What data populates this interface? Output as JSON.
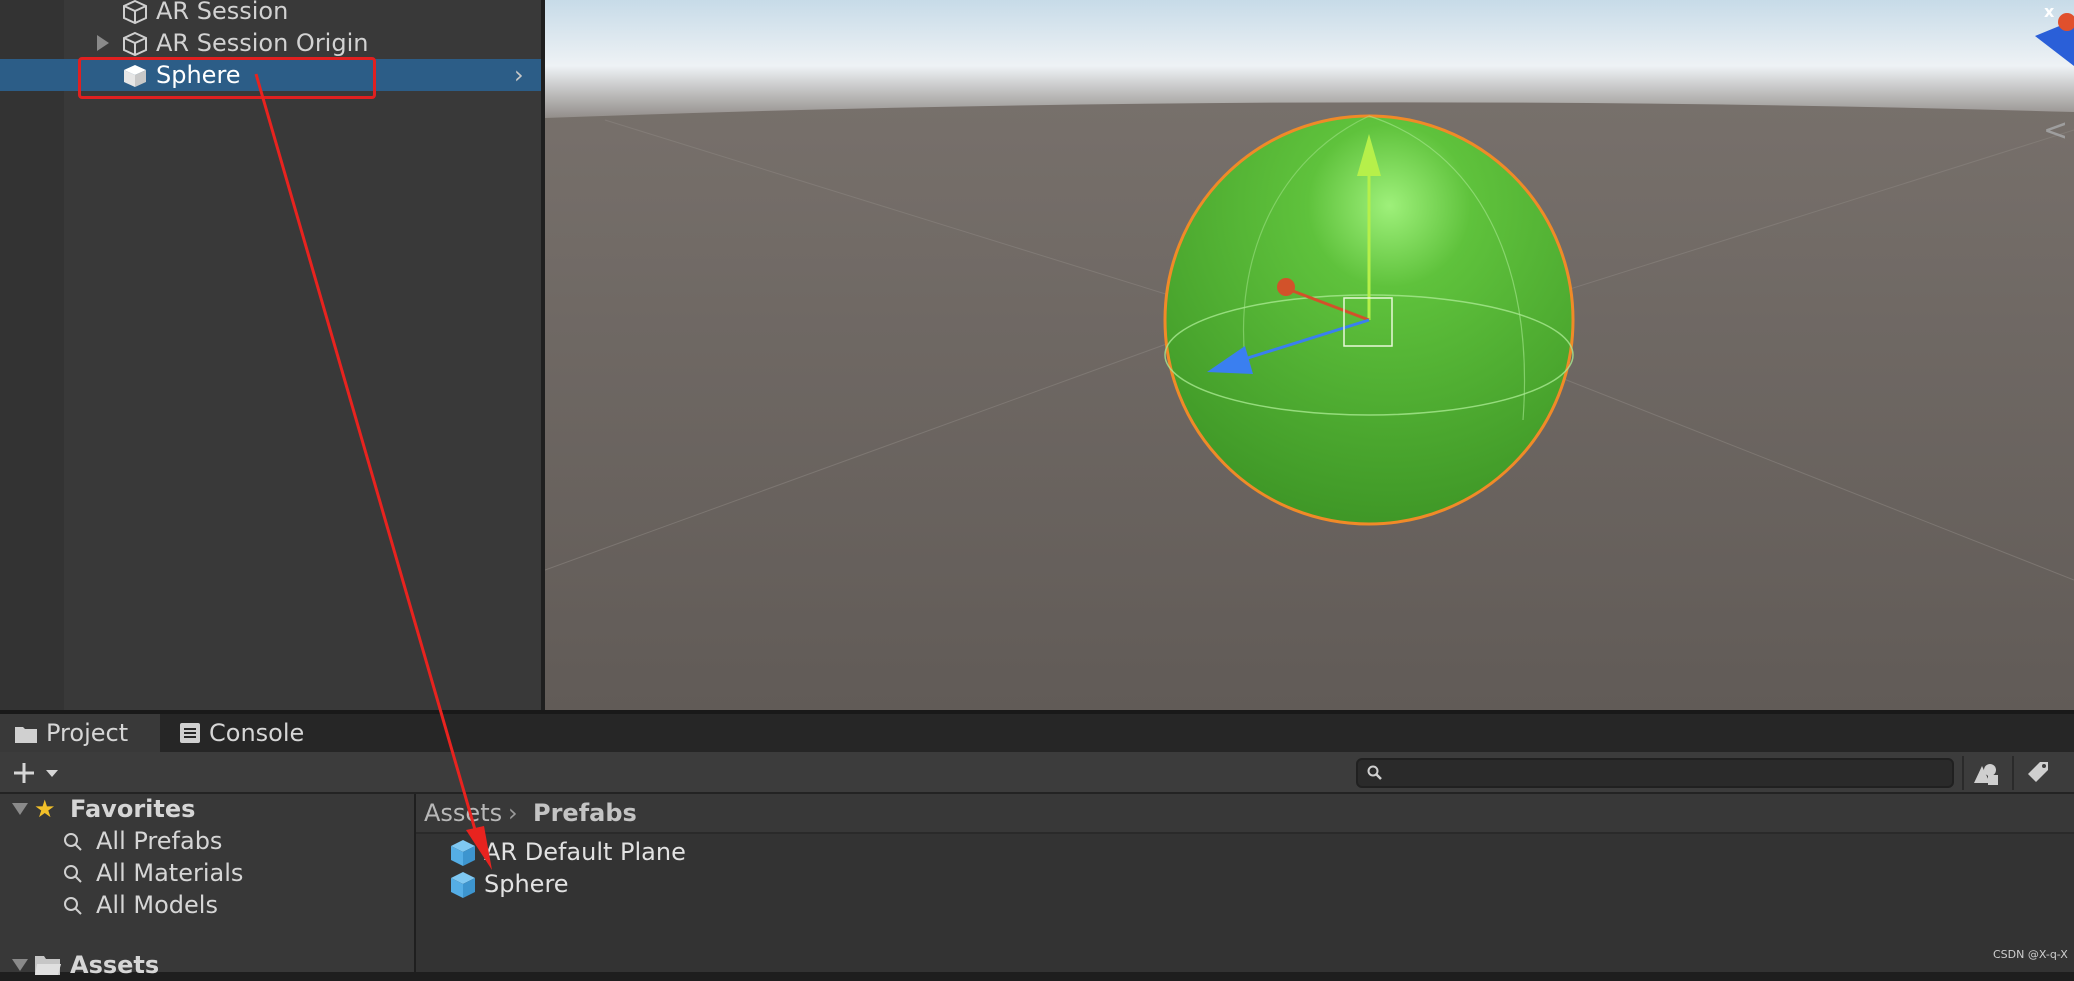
{
  "hierarchy": {
    "items": [
      {
        "label": "AR Session",
        "has_children": false,
        "selected": false
      },
      {
        "label": "AR Session Origin",
        "has_children": true,
        "selected": false
      },
      {
        "label": "Sphere",
        "has_children": false,
        "selected": true
      }
    ]
  },
  "scene_view": {
    "axis_label": "x",
    "selected_object": "Sphere",
    "object_color": "#4ea32e",
    "outline_color": "#f08a28",
    "gizmo_colors": {
      "x": "#d2522a",
      "y": "#b6f04a",
      "z": "#3a7ff0"
    }
  },
  "bottom_panel": {
    "tabs": [
      {
        "label": "Project",
        "icon": "folder-icon",
        "active": true
      },
      {
        "label": "Console",
        "icon": "console-icon",
        "active": false
      }
    ],
    "search": {
      "placeholder": "",
      "value": ""
    },
    "tree": {
      "favorites": {
        "label": "Favorites",
        "items": [
          "All Prefabs",
          "All Materials",
          "All Models"
        ]
      },
      "assets": {
        "label": "Assets"
      }
    },
    "breadcrumb": [
      "Assets",
      "Prefabs"
    ],
    "assets": [
      {
        "label": "AR Default Plane",
        "icon": "prefab-icon"
      },
      {
        "label": "Sphere",
        "icon": "prefab-icon"
      }
    ]
  },
  "annotation": {
    "color": "#e8231f"
  },
  "watermark": "CSDN @X-q-X"
}
